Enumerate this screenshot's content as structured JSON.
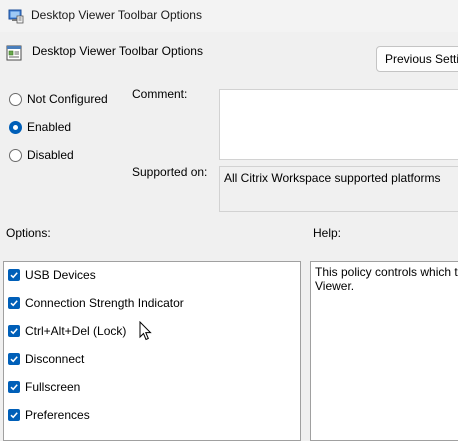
{
  "window": {
    "title": "Desktop Viewer Toolbar Options",
    "icon": "policy-window-icon"
  },
  "header": {
    "title": "Desktop Viewer Toolbar Options",
    "icon": "policy-setting-icon",
    "prev_button": "Previous Setting"
  },
  "state": {
    "options": [
      {
        "label": "Not Configured",
        "selected": false
      },
      {
        "label": "Enabled",
        "selected": true
      },
      {
        "label": "Disabled",
        "selected": false
      }
    ]
  },
  "comment": {
    "label": "Comment:",
    "value": ""
  },
  "supported": {
    "label": "Supported on:",
    "value": "All Citrix Workspace supported platforms"
  },
  "options_panel": {
    "label": "Options:",
    "items": [
      {
        "label": "USB Devices",
        "checked": true
      },
      {
        "label": "Connection Strength Indicator",
        "checked": true
      },
      {
        "label": "Ctrl+Alt+Del (Lock)",
        "checked": true
      },
      {
        "label": "Disconnect",
        "checked": true
      },
      {
        "label": "Fullscreen",
        "checked": true
      },
      {
        "label": "Preferences",
        "checked": true
      }
    ]
  },
  "help_panel": {
    "label": "Help:",
    "text": "This policy controls which t\nViewer."
  },
  "colors": {
    "accent": "#005fb8",
    "window_bg": "#f0f0f0"
  }
}
